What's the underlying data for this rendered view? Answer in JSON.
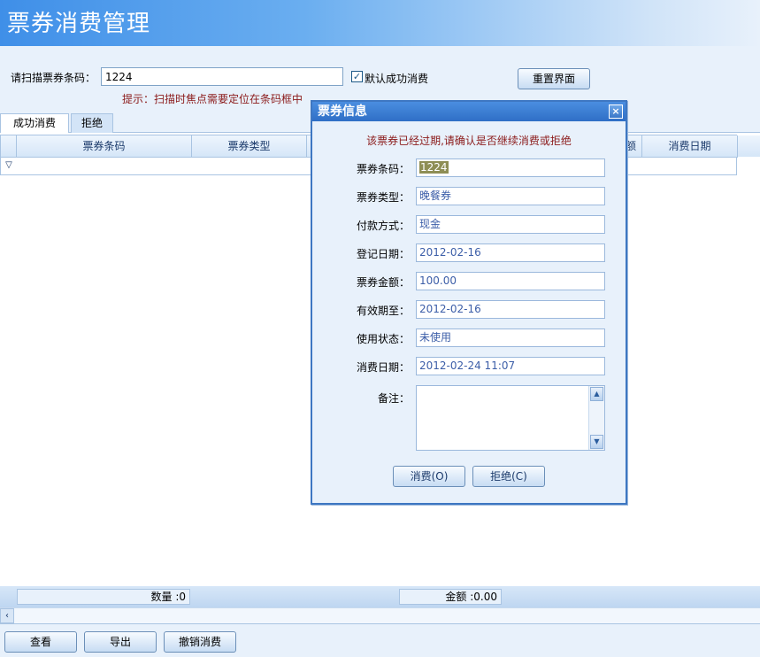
{
  "window": {
    "title": "票券消费管理"
  },
  "scan": {
    "label": "请扫描票券条码：",
    "value": "1224",
    "default_success_label": "默认成功消费",
    "default_success_checked": true,
    "hint": "提示：扫描时焦点需要定位在条码框中",
    "reset_button": "重置界面"
  },
  "tabs": [
    {
      "label": "成功消费",
      "active": true
    },
    {
      "label": "拒绝",
      "active": false
    }
  ],
  "grid": {
    "columns": [
      "票券条码",
      "票券类型",
      "消费日期"
    ],
    "partial_column": "额"
  },
  "summary": {
    "count": "数量 :0",
    "amount": "金额 :0.00"
  },
  "bottom_buttons": [
    "查看",
    "导出",
    "撤销消费"
  ],
  "dialog": {
    "title": "票券信息",
    "warning": "该票券已经过期,请确认是否继续消费或拒绝",
    "fields": [
      {
        "label": "票券条码：",
        "value": "1224"
      },
      {
        "label": "票券类型：",
        "value": "晚餐券"
      },
      {
        "label": "付款方式：",
        "value": "现金"
      },
      {
        "label": "登记日期：",
        "value": "2012-02-16"
      },
      {
        "label": "票券金额：",
        "value": "100.00"
      },
      {
        "label": "有效期至：",
        "value": "2012-02-16"
      },
      {
        "label": "使用状态：",
        "value": "未使用"
      },
      {
        "label": "消费日期：",
        "value": "2012-02-24 11:07"
      }
    ],
    "memo_label": "备注：",
    "consume_button": "消费(O)",
    "reject_button": "拒绝(C)"
  }
}
